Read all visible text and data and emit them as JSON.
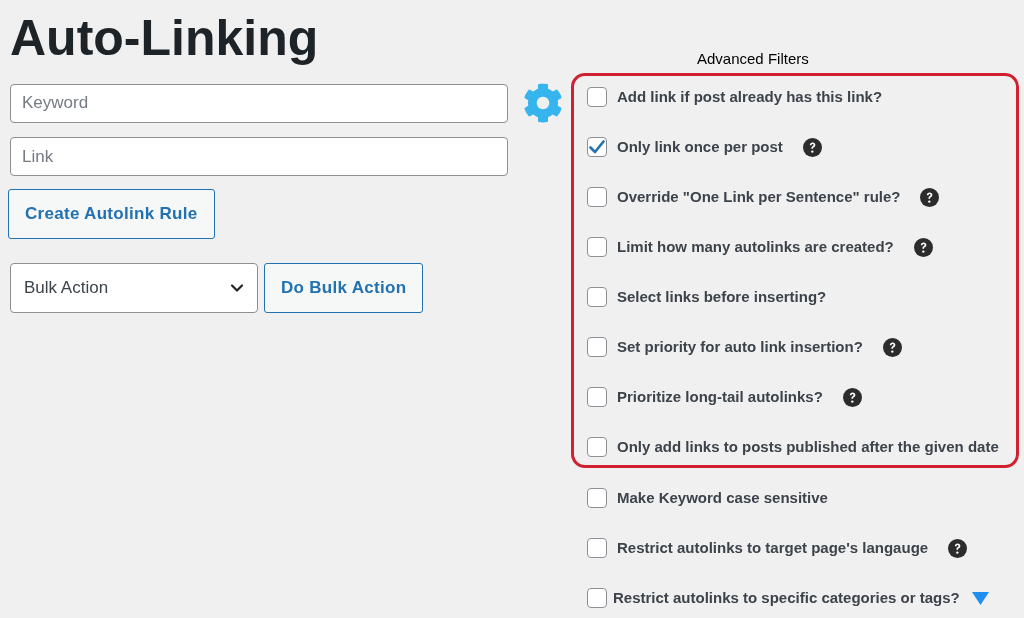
{
  "title": "Auto-Linking",
  "rule_form": {
    "keyword_field": {
      "placeholder": "Keyword"
    },
    "link_field": {
      "placeholder": "Link"
    },
    "create_button": "Create Autolink Rule"
  },
  "bulk_actions": {
    "select": {
      "value": "Bulk Action"
    },
    "apply_button": "Do Bulk Action"
  },
  "advanced_filters": {
    "title": "Advanced Filters",
    "highlighted_options": [
      {
        "label": "Add link if post already has this link?",
        "checked": false,
        "kind": "plain"
      },
      {
        "label": "Only link once per post",
        "checked": true,
        "kind": "help"
      },
      {
        "label": "Override \"One Link per Sentence\" rule?",
        "checked": false,
        "kind": "help"
      },
      {
        "label": "Limit how many autolinks are created?",
        "checked": false,
        "kind": "help"
      },
      {
        "label": "Select links before inserting?",
        "checked": false,
        "kind": "plain"
      },
      {
        "label": "Set priority for auto link insertion?",
        "checked": false,
        "kind": "help"
      },
      {
        "label": "Prioritize long-tail autolinks?",
        "checked": false,
        "kind": "help"
      },
      {
        "label": "Only add links to posts published after the given date",
        "checked": false,
        "kind": "plain"
      }
    ],
    "more_options": [
      {
        "label": "Make Keyword case sensitive",
        "checked": false,
        "kind": "plain"
      },
      {
        "label": "Restrict autolinks to target page's langauge",
        "checked": false,
        "kind": "help"
      },
      {
        "label": "Restrict autolinks to specific categories or tags?",
        "checked": false,
        "kind": "expander"
      }
    ]
  }
}
